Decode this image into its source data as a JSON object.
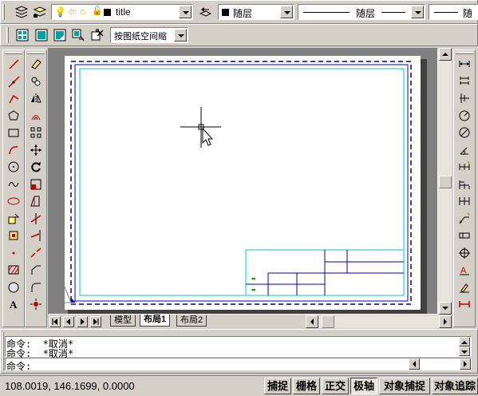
{
  "layer_toolbar": {
    "layer_name": "title",
    "color_value": "随层",
    "linetype_value": "随层",
    "lineweight_value": "随"
  },
  "view_toolbar": {
    "scale_value": "按图纸空间缩"
  },
  "layout_tabs": {
    "tabs": [
      {
        "label": "模型",
        "active": false
      },
      {
        "label": "布局1",
        "active": true
      },
      {
        "label": "布局2",
        "active": false
      }
    ]
  },
  "command_window": {
    "lines": [
      "命令:  *取消*",
      "命令:  *取消*",
      "命令:"
    ]
  },
  "status_bar": {
    "coordinates": "108.0019, 146.1699, 0.0000",
    "toggles": [
      {
        "label": "捕捉",
        "on": false
      },
      {
        "label": "栅格",
        "on": false
      },
      {
        "label": "正交",
        "on": false
      },
      {
        "label": "极轴",
        "on": true
      },
      {
        "label": "对象捕捉",
        "on": false
      },
      {
        "label": "对象追踪",
        "on": false
      }
    ]
  },
  "title_block": {
    "marks": [
      "▪▪",
      "▪▪"
    ]
  },
  "colors": {
    "canvas_bg": "#808080",
    "paper": "#ffffff",
    "viewport_border": "#00c8c8",
    "title_block": "#0000aa",
    "dash_border": "#000080"
  },
  "icons": {
    "draw_tools": [
      "line-icon",
      "construction-line-icon",
      "polyline-icon",
      "polygon-icon",
      "rectangle-icon",
      "arc-icon",
      "circle-icon",
      "spline-icon",
      "ellipse-icon",
      "insert-block-icon",
      "make-block-icon",
      "point-icon",
      "hatch-icon",
      "region-icon",
      "text-icon"
    ],
    "modify_tools": [
      "erase-icon",
      "copy-icon",
      "mirror-icon",
      "offset-icon",
      "array-icon",
      "move-icon",
      "rotate-icon",
      "scale-icon",
      "stretch-icon",
      "trim-icon",
      "extend-icon",
      "break-icon",
      "chamfer-icon",
      "fillet-icon",
      "explode-icon"
    ],
    "dim_tools": [
      "linear-dim-icon",
      "aligned-dim-icon",
      "ordinate-dim-icon",
      "radius-dim-icon",
      "diameter-dim-icon",
      "angular-dim-icon",
      "quick-dim-icon",
      "baseline-dim-icon",
      "continue-dim-icon",
      "leader-icon",
      "tolerance-icon",
      "center-mark-icon",
      "dim-edit-icon",
      "dim-text-edit-icon",
      "dim-style-icon"
    ]
  }
}
